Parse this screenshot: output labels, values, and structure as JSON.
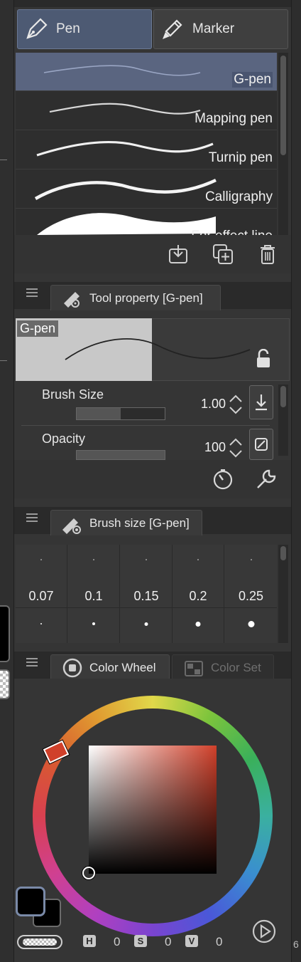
{
  "brush_tabs": [
    {
      "label": "Pen",
      "icon": "pen-icon",
      "active": true
    },
    {
      "label": "Marker",
      "icon": "marker-icon",
      "active": false
    }
  ],
  "brushes": [
    {
      "label": "G-pen",
      "selected": true
    },
    {
      "label": "Mapping pen",
      "selected": false
    },
    {
      "label": "Turnip pen",
      "selected": false
    },
    {
      "label": "Calligraphy",
      "selected": false
    },
    {
      "label": "For effect line",
      "selected": false
    }
  ],
  "brush_tools": [
    "import-brush-icon",
    "duplicate-brush-icon",
    "delete-brush-icon"
  ],
  "tool_property": {
    "title": "Tool property [G-pen]",
    "preview_label": "G-pen",
    "brush_size_label": "Brush Size",
    "brush_size_value": "1.00",
    "opacity_label": "Opacity",
    "opacity_value": "100",
    "brush_size_fill": 0.5,
    "opacity_fill": 1.0
  },
  "brush_size_panel": {
    "title": "Brush size [G-pen]",
    "sizes": [
      "0.07",
      "0.1",
      "0.15",
      "0.2",
      "0.25"
    ]
  },
  "color_panel": {
    "tab_active": "Color Wheel",
    "tab_inactive": "Color Set",
    "hsv": {
      "h_label": "H",
      "h": "0",
      "s_label": "S",
      "s": "0",
      "v_label": "V",
      "v": "0"
    },
    "main_color": "#000000",
    "sub_color": "#000000",
    "hue_color": "#d0402a"
  },
  "right_edge_text": "6"
}
